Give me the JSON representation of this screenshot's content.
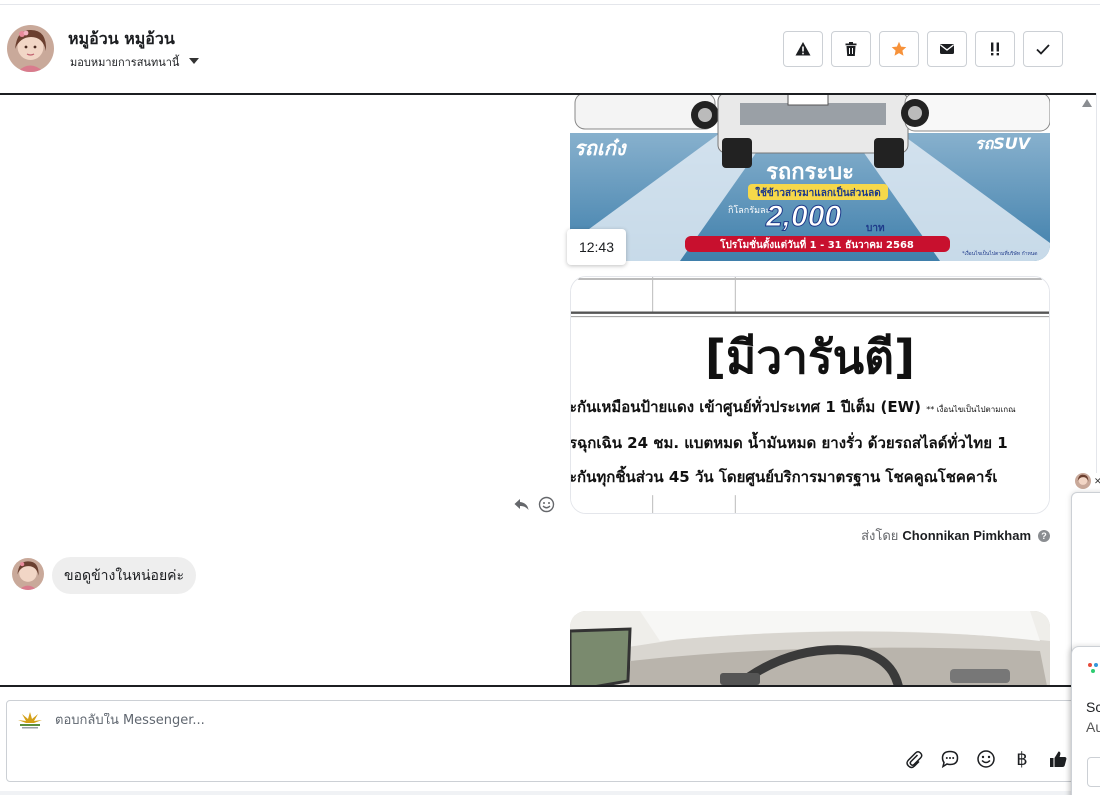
{
  "header": {
    "contact_name": "หมูอ้วน หมูอ้วน",
    "assign_label": "มอบหมายการสนทนานี้",
    "actions": [
      {
        "name": "spam-button",
        "icon": "warning-icon"
      },
      {
        "name": "delete-button",
        "icon": "trash-icon"
      },
      {
        "name": "star-button",
        "icon": "star-icon"
      },
      {
        "name": "mark-unread-button",
        "icon": "envelope-icon"
      },
      {
        "name": "mark-important-button",
        "icon": "double-exclamation-icon"
      },
      {
        "name": "mark-done-button",
        "icon": "check-icon"
      }
    ],
    "star_color": "#f7923a"
  },
  "thread": {
    "promo_image": {
      "left_label": "รถเก๋ง",
      "center_label": "รถกระบะ",
      "right_label": "รถSUV",
      "trade_in": "ใช้ข้าวสารมาแลกเป็นส่วนลด",
      "per_kg": "กิโลกรัมละ",
      "amount": "2,000",
      "currency": "บาท",
      "period": "โปรโมชั่นตั้งแต่วันที่ 1 - 31 ธันวาคม 2568",
      "footnote": "*เงื่อนไขเป็นไปตามที่บริษัท กำหนด"
    },
    "time_tooltip": "12:43",
    "warranty_image": {
      "title": "[มีวารันตี]",
      "lines": [
        "ะกันเหมือนป้ายแดง เข้าศูนย์ทั่วประเทศ 1 ปีเต็ม (EW)",
        "รฉุกเฉิน 24 ชม. แบตหมด น้ำมันหมด ยางรั่ว ด้วยรถสไลด์ทั่วไทย 1",
        "ะกันทุกชิ้นส่วน 45 วัน โดยศูนย์บริการมาตรฐาน โชคคูณโชคคาร์เ"
      ],
      "line1_note": "** เงื่อนไขเป็นไปตามเกณ"
    },
    "sent_by_prefix": "ส่งโดย",
    "sent_by_name": "Chonnikan Pimkham",
    "help_glyph": "?",
    "incoming_message": "ขอดูข้างในหน่อยค่ะ"
  },
  "composer": {
    "placeholder": "ตอบกลับใน Messenger...",
    "tools": [
      "attachment-icon",
      "saved-replies-icon",
      "emoji-icon",
      "payment-icon",
      "like-icon"
    ],
    "currency_symbol": "฿"
  },
  "popup": {
    "line1": "Sc",
    "line2": "Au"
  },
  "colors": {
    "border": "#ccd0d5",
    "bubble": "#eeeeee",
    "like": "#1c1e21"
  }
}
